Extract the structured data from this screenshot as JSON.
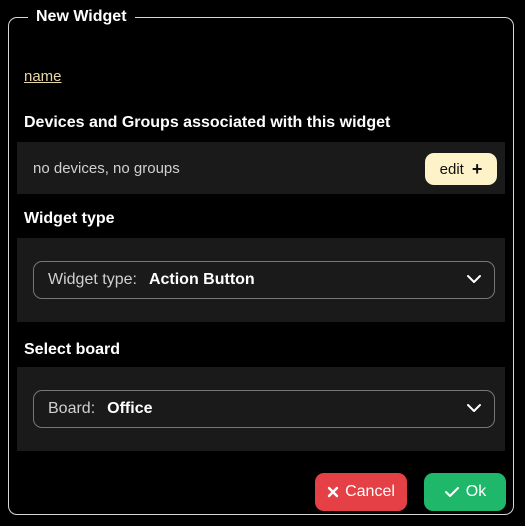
{
  "dialog": {
    "title": "New Widget",
    "name_link": "name"
  },
  "devices": {
    "heading": "Devices and  Groups associated with this widget",
    "summary": "no devices, no groups",
    "edit_label": "edit",
    "edit_icon": "plus-icon"
  },
  "widget_type": {
    "heading": "Widget type",
    "prefix": "Widget type:",
    "value": "Action Button",
    "icon": "chevron-down-icon"
  },
  "board": {
    "heading": "Select board",
    "prefix": "Board:",
    "value": "Office",
    "icon": "chevron-down-icon"
  },
  "actions": {
    "cancel_label": "Cancel",
    "cancel_icon": "close-icon",
    "ok_label": "Ok",
    "ok_icon": "check-icon"
  },
  "colors": {
    "background": "#000000",
    "panel": "#1a1a1a",
    "edit_button": "#fdf2c8",
    "cancel": "#e44046",
    "ok": "#1fb86a",
    "link": "#e8d8a8"
  }
}
